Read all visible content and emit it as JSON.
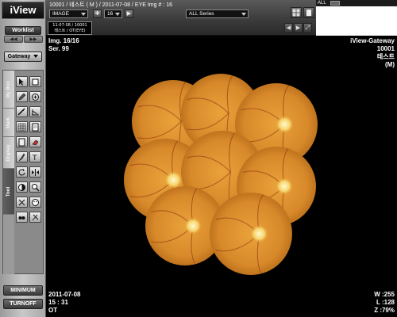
{
  "app": {
    "logo": "iView"
  },
  "sidebar": {
    "worklist_label": "Worklist",
    "gateway_label": "Gateway",
    "tabs": [
      "My Box",
      "Mark",
      "Display",
      "Tool"
    ],
    "minimum_label": "MINIMUM",
    "turnoff_label": "TURNOFF"
  },
  "topbar": {
    "info_line": "10001  /  테스트 ( M )  /  2011-07-08  /  EYE    Img # : 16",
    "modality_select": "IMAGE",
    "frame_value": "16",
    "series_select": "ALL Series",
    "thumb_line1": "11-07-08 / 10001",
    "thumb_line2": "테스트 / OT(EYE)"
  },
  "corner": {
    "all_label": "ALL"
  },
  "overlay": {
    "img": "Img. 16/16",
    "ser": "Ser. 99",
    "server": "iView-Gateway",
    "patient_id": "10001",
    "patient_name": "테스트",
    "sex": "(M)",
    "date": "2011-07-08",
    "time": "15 : 31",
    "modality": "OT",
    "window": "W :255",
    "level": "L :128",
    "zoom": "Z :79%"
  },
  "colors": {
    "fundus": "#d88a24",
    "fundus_dark": "#a65a12",
    "disc": "#fff3b0",
    "vessel": "#8a2e10"
  }
}
